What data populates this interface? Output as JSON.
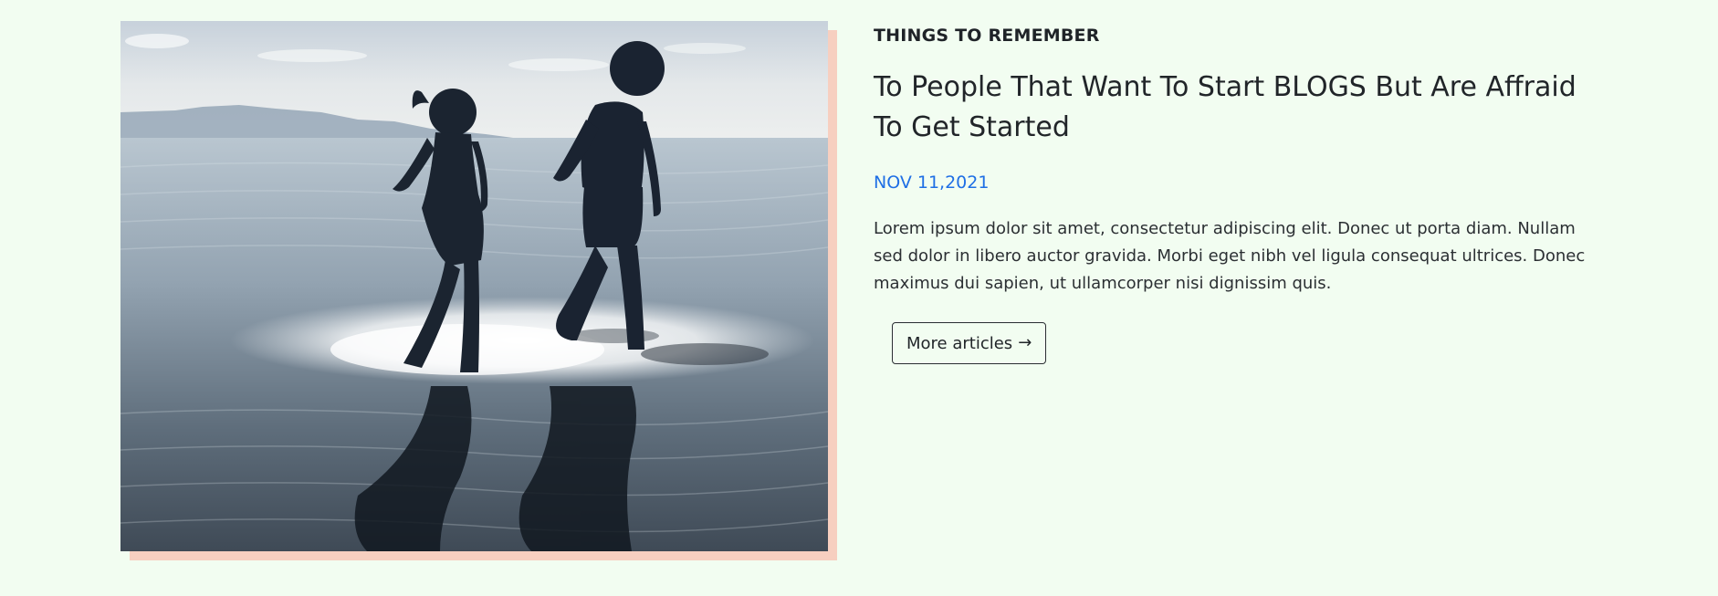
{
  "article": {
    "category": "THINGS TO REMEMBER",
    "title": "To People That Want To Start BLOGS But Are Affraid To Get Started",
    "date": "NOV 11,2021",
    "excerpt": "Lorem ipsum dolor sit amet, consectetur adipiscing elit. Donec ut porta diam. Nullam sed dolor in libero auctor gravida. Morbi eget nibh vel ligula consequat ultrices. Donec maximus dui sapien, ut ullamcorper nisi dignissim quis.",
    "image_alt": "Two children walking in shallow water at sunset",
    "button": {
      "label": "More articles",
      "icon": "arrow-right-icon",
      "arrow": "→"
    }
  },
  "colors": {
    "background": "#f2fdf1",
    "image_shadow": "#f7cfc0",
    "date": "#1f6fe5",
    "text": "#212529"
  }
}
